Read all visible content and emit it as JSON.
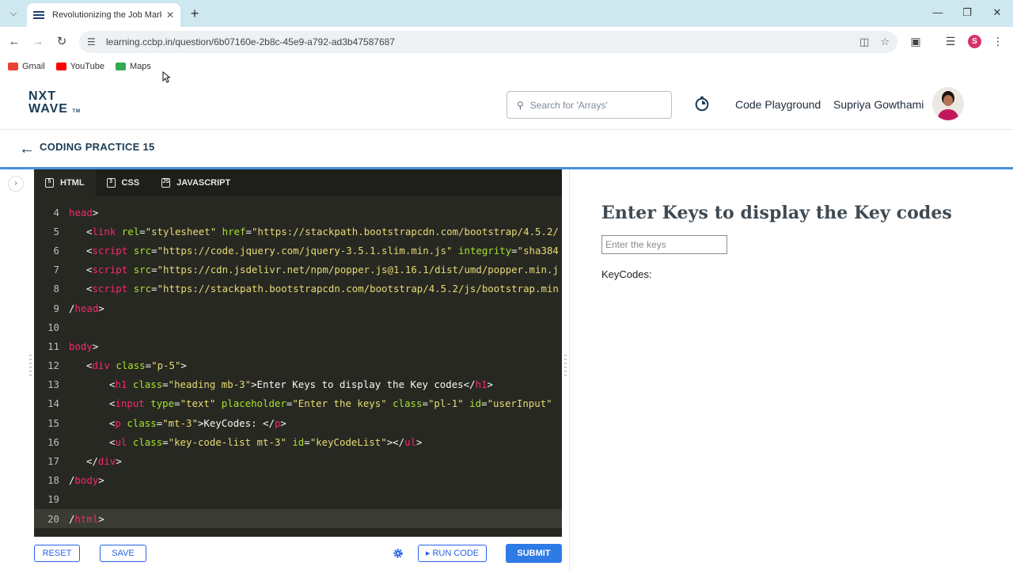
{
  "browser": {
    "tab_title": "Revolutionizing the Job Market",
    "url": "learning.ccbp.in/question/6b07160e-2b8c-45e9-a792-ad3b47587687",
    "profile_initial": "S",
    "bookmarks": [
      {
        "label": "Gmail",
        "color": "#ea4335"
      },
      {
        "label": "YouTube",
        "color": "#ff0000"
      },
      {
        "label": "Maps",
        "color": "#34a853"
      }
    ]
  },
  "header": {
    "logo_line1": "NXT",
    "logo_line2": "WAVE",
    "logo_tm": "TM",
    "search_placeholder": "Search for 'Arrays'",
    "code_playground": "Code Playground",
    "user_name": "Supriya Gowthami"
  },
  "practice": {
    "title": "CODING PRACTICE 15"
  },
  "editor": {
    "tabs": [
      {
        "label": "HTML",
        "icon": "html-icon",
        "active": true
      },
      {
        "label": "CSS",
        "icon": "css-icon",
        "active": false
      },
      {
        "label": "JAVASCRIPT",
        "icon": "javascript-icon",
        "active": false
      }
    ],
    "lines": [
      {
        "n": "4",
        "indent": 0,
        "parts": [
          [
            "tag",
            "head"
          ],
          [
            "pl",
            ">"
          ]
        ]
      },
      {
        "n": "5",
        "indent": 1,
        "parts": [
          [
            "pl",
            "<"
          ],
          [
            "tag",
            "link"
          ],
          [
            "pl",
            " "
          ],
          [
            "attr",
            "rel"
          ],
          [
            "pl",
            "="
          ],
          [
            "str",
            "\"stylesheet\""
          ],
          [
            "pl",
            " "
          ],
          [
            "attr",
            "href"
          ],
          [
            "pl",
            "="
          ],
          [
            "str",
            "\"https://stackpath.bootstrapcdn.com/bootstrap/4.5.2/"
          ]
        ]
      },
      {
        "n": "6",
        "indent": 1,
        "parts": [
          [
            "pl",
            "<"
          ],
          [
            "tag",
            "script"
          ],
          [
            "pl",
            " "
          ],
          [
            "attr",
            "src"
          ],
          [
            "pl",
            "="
          ],
          [
            "str",
            "\"https://code.jquery.com/jquery-3.5.1.slim.min.js\""
          ],
          [
            "pl",
            " "
          ],
          [
            "attr",
            "integrity"
          ],
          [
            "pl",
            "="
          ],
          [
            "str",
            "\"sha384"
          ]
        ]
      },
      {
        "n": "7",
        "indent": 1,
        "parts": [
          [
            "pl",
            "<"
          ],
          [
            "tag",
            "script"
          ],
          [
            "pl",
            " "
          ],
          [
            "attr",
            "src"
          ],
          [
            "pl",
            "="
          ],
          [
            "str",
            "\"https://cdn.jsdelivr.net/npm/popper.js@1.16.1/dist/umd/popper.min.j"
          ]
        ]
      },
      {
        "n": "8",
        "indent": 1,
        "parts": [
          [
            "pl",
            "<"
          ],
          [
            "tag",
            "script"
          ],
          [
            "pl",
            " "
          ],
          [
            "attr",
            "src"
          ],
          [
            "pl",
            "="
          ],
          [
            "str",
            "\"https://stackpath.bootstrapcdn.com/bootstrap/4.5.2/js/bootstrap.min"
          ]
        ]
      },
      {
        "n": "9",
        "indent": 0,
        "parts": [
          [
            "pl",
            "/"
          ],
          [
            "tag",
            "head"
          ],
          [
            "pl",
            ">"
          ]
        ]
      },
      {
        "n": "10",
        "indent": 0,
        "parts": []
      },
      {
        "n": "11",
        "indent": 0,
        "parts": [
          [
            "tag",
            "body"
          ],
          [
            "pl",
            ">"
          ]
        ]
      },
      {
        "n": "12",
        "indent": 1,
        "parts": [
          [
            "pl",
            "<"
          ],
          [
            "tag",
            "div"
          ],
          [
            "pl",
            " "
          ],
          [
            "attr",
            "class"
          ],
          [
            "pl",
            "="
          ],
          [
            "str",
            "\"p-5\""
          ],
          [
            "pl",
            ">"
          ]
        ]
      },
      {
        "n": "13",
        "indent": 2,
        "parts": [
          [
            "pl",
            "<"
          ],
          [
            "tag",
            "h1"
          ],
          [
            "pl",
            " "
          ],
          [
            "attr",
            "class"
          ],
          [
            "pl",
            "="
          ],
          [
            "str",
            "\"heading mb-3\""
          ],
          [
            "pl",
            ">Enter Keys to display the Key codes</"
          ],
          [
            "tag",
            "h1"
          ],
          [
            "pl",
            ">"
          ]
        ]
      },
      {
        "n": "14",
        "indent": 2,
        "parts": [
          [
            "pl",
            "<"
          ],
          [
            "tag",
            "input"
          ],
          [
            "pl",
            " "
          ],
          [
            "attr",
            "type"
          ],
          [
            "pl",
            "="
          ],
          [
            "str",
            "\"text\""
          ],
          [
            "pl",
            " "
          ],
          [
            "attr",
            "placeholder"
          ],
          [
            "pl",
            "="
          ],
          [
            "str",
            "\"Enter the keys\""
          ],
          [
            "pl",
            " "
          ],
          [
            "attr",
            "class"
          ],
          [
            "pl",
            "="
          ],
          [
            "str",
            "\"pl-1\""
          ],
          [
            "pl",
            " "
          ],
          [
            "attr",
            "id"
          ],
          [
            "pl",
            "="
          ],
          [
            "str",
            "\"userInput\""
          ]
        ]
      },
      {
        "n": "15",
        "indent": 2,
        "parts": [
          [
            "pl",
            "<"
          ],
          [
            "tag",
            "p"
          ],
          [
            "pl",
            " "
          ],
          [
            "attr",
            "class"
          ],
          [
            "pl",
            "="
          ],
          [
            "str",
            "\"mt-3\""
          ],
          [
            "pl",
            ">KeyCodes: </"
          ],
          [
            "tag",
            "p"
          ],
          [
            "pl",
            ">"
          ]
        ]
      },
      {
        "n": "16",
        "indent": 2,
        "parts": [
          [
            "pl",
            "<"
          ],
          [
            "tag",
            "ul"
          ],
          [
            "pl",
            " "
          ],
          [
            "attr",
            "class"
          ],
          [
            "pl",
            "="
          ],
          [
            "str",
            "\"key-code-list mt-3\""
          ],
          [
            "pl",
            " "
          ],
          [
            "attr",
            "id"
          ],
          [
            "pl",
            "="
          ],
          [
            "str",
            "\"keyCodeList\""
          ],
          [
            "pl",
            "></"
          ],
          [
            "tag",
            "ul"
          ],
          [
            "pl",
            ">"
          ]
        ]
      },
      {
        "n": "17",
        "indent": 1,
        "parts": [
          [
            "pl",
            "</"
          ],
          [
            "tag",
            "div"
          ],
          [
            "pl",
            ">"
          ]
        ]
      },
      {
        "n": "18",
        "indent": 0,
        "parts": [
          [
            "pl",
            "/"
          ],
          [
            "tag",
            "body"
          ],
          [
            "pl",
            ">"
          ]
        ]
      },
      {
        "n": "19",
        "indent": 0,
        "parts": []
      },
      {
        "n": "20",
        "indent": 0,
        "current": true,
        "parts": [
          [
            "pl",
            "/"
          ],
          [
            "tag",
            "html"
          ],
          [
            "pl",
            ">"
          ]
        ]
      }
    ]
  },
  "actions": {
    "reset": "RESET",
    "save": "SAVE",
    "run_code": "RUN CODE",
    "submit": "SUBMIT"
  },
  "preview": {
    "heading": "Enter Keys to display the Key codes",
    "input_placeholder": "Enter the keys",
    "keycodes_label": "KeyCodes:"
  },
  "colors": {
    "brand_navy": "#183b56",
    "primary_blue": "#2f7be5",
    "editor_bg": "#272822"
  }
}
